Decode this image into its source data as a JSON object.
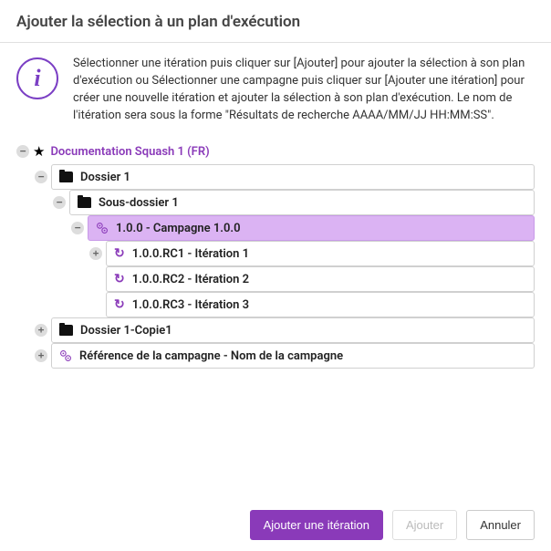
{
  "dialog": {
    "title": "Ajouter la sélection à un plan d'exécution",
    "info_text": "Sélectionner une itération puis cliquer sur [Ajouter] pour ajouter la sélection à son plan d'exécution ou Sélectionner une campagne puis cliquer sur [Ajouter une itération] pour créer une nouvelle itération et ajouter la sélection à son plan d'exécution. Le nom de l'itération sera sous la forme \"Résultats de recherche AAAA/MM/JJ HH:MM:SS\"."
  },
  "tree": {
    "root": "Documentation Squash 1 (FR)",
    "nodes": {
      "dossier1": "Dossier 1",
      "sousdossier1": "Sous-dossier 1",
      "campagne100": "1.0.0 - Campagne 1.0.0",
      "iter1": "1.0.0.RC1 - Itération 1",
      "iter2": "1.0.0.RC2 - Itération 2",
      "iter3": "1.0.0.RC3 - Itération 3",
      "dossier1copie": "Dossier 1-Copie1",
      "campagneRef": "Référence de la campagne - Nom de la campagne"
    }
  },
  "buttons": {
    "add_iteration": "Ajouter une itération",
    "add": "Ajouter",
    "cancel": "Annuler"
  }
}
